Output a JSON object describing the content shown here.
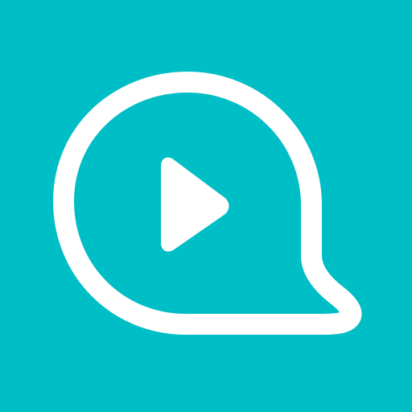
{
  "app_icon": {
    "icon_name": "chat-bubble-play-icon",
    "colors": {
      "background": "#00BEC5",
      "foreground": "#FFFFFF"
    }
  }
}
